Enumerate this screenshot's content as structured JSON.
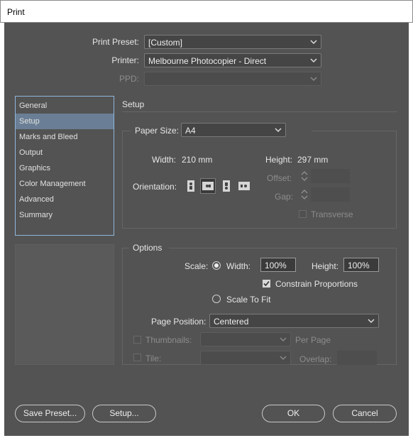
{
  "window": {
    "title": "Print"
  },
  "top": {
    "print_preset_label": "Print Preset:",
    "print_preset_value": "[Custom]",
    "printer_label": "Printer:",
    "printer_value": "Melbourne Photocopier - Direct",
    "ppd_label": "PPD:",
    "ppd_value": ""
  },
  "sidebar": {
    "items": [
      {
        "label": "General"
      },
      {
        "label": "Setup"
      },
      {
        "label": "Marks and Bleed"
      },
      {
        "label": "Output"
      },
      {
        "label": "Graphics"
      },
      {
        "label": "Color Management"
      },
      {
        "label": "Advanced"
      },
      {
        "label": "Summary"
      }
    ],
    "selected": "Setup"
  },
  "setup": {
    "heading": "Setup",
    "paper_size_label": "Paper Size:",
    "paper_size_value": "A4",
    "width_label": "Width:",
    "width_value": "210 mm",
    "height_label": "Height:",
    "height_value": "297 mm",
    "orientation_label": "Orientation:",
    "offset_label": "Offset:",
    "gap_label": "Gap:",
    "transverse_label": "Transverse"
  },
  "options": {
    "heading": "Options",
    "scale_label": "Scale:",
    "width_radio_label": "Width:",
    "width_scale_value": "100%",
    "height_label": "Height:",
    "height_scale_value": "100%",
    "constrain_label": "Constrain Proportions",
    "scale_to_fit_label": "Scale To Fit",
    "page_position_label": "Page Position:",
    "page_position_value": "Centered",
    "thumbnails_label": "Thumbnails:",
    "per_page_label": "Per Page",
    "tile_label": "Tile:",
    "overlap_label": "Overlap:"
  },
  "buttons": {
    "save_preset": "Save Preset...",
    "setup": "Setup...",
    "ok": "OK",
    "cancel": "Cancel"
  },
  "colors": {
    "dialog_bg": "#535353",
    "selection": "#6a7f95",
    "focus_border": "#8fb6dc"
  }
}
